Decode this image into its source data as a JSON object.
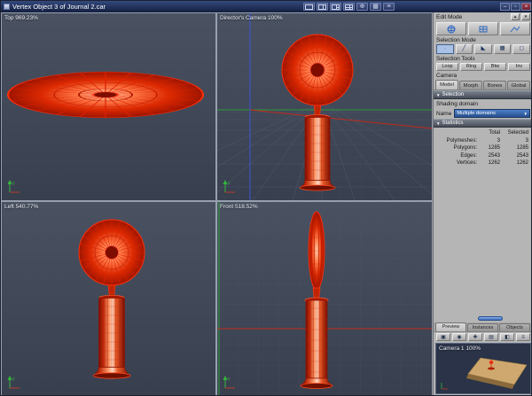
{
  "titlebar": {
    "title": "Vertex Object 3 of Journal 2.car"
  },
  "viewports": {
    "top": {
      "label": "Top 969.23%"
    },
    "camera": {
      "label": "Director's Camera 100%"
    },
    "left": {
      "label": "Left 540.77%"
    },
    "front": {
      "label": "Front 518.52%"
    }
  },
  "panel": {
    "edit_mode_label": "Edit Mode",
    "selection_mode_label": "Selection Mode",
    "selection_tools_label": "Selection Tools",
    "selection_tool_buttons": [
      "Loop",
      "Ring",
      "Btw",
      "Inv"
    ],
    "camera_label": "Camera",
    "tabs": [
      "Model",
      "Morph",
      "Bones",
      "Global"
    ],
    "selection_section": {
      "title": "Selection",
      "shading_domain": "Shading domain",
      "name_label": "Name",
      "name_value": "Multiple domains"
    },
    "statistics": {
      "title": "Statistics",
      "columns": [
        "Total",
        "Selected"
      ],
      "rows": [
        {
          "label": "Polymeshes:",
          "total": "3",
          "selected": "3"
        },
        {
          "label": "Polygons:",
          "total": "1285",
          "selected": "1285"
        },
        {
          "label": "Edges:",
          "total": "2543",
          "selected": "2543"
        },
        {
          "label": "Vertices:",
          "total": "1262",
          "selected": "1262"
        }
      ]
    },
    "bottom_tabs": [
      "Preview",
      "Instances",
      "Objects"
    ],
    "preview_label": "Camera 1 100%"
  },
  "icons": {
    "expand": "▴",
    "collapse": "▾",
    "section_arrow": "▼",
    "dropdown_arrow": "▼",
    "minimize": "–",
    "maximize": "▫",
    "close": "×",
    "camera_tool": "⊕",
    "display_tool": "▦",
    "menu_tool": "≡",
    "sel_point": "·",
    "sel_edge": "╱",
    "sel_face": "◣",
    "sel_mesh": "▦",
    "sel_object": "◻",
    "preview_icons": [
      "▣",
      "◉",
      "✚",
      "▤",
      "◧",
      "≡"
    ]
  },
  "colors": {
    "wireframe_red": "#dc2a02",
    "axis_green": "#2f9a3a",
    "axis_blue": "#3b55d6",
    "axis_red": "#c22a1a",
    "accent_blue": "#27508e"
  }
}
